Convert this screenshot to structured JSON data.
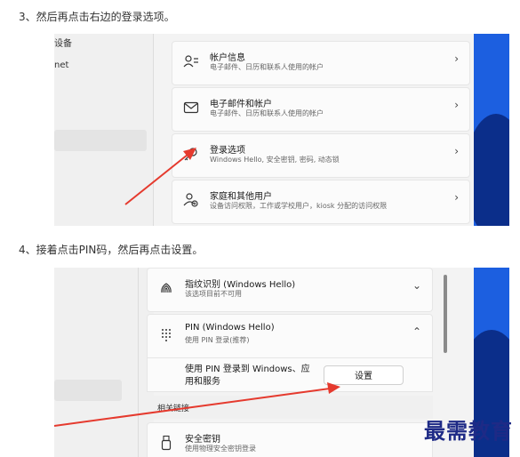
{
  "step3": "3、然后再点击右边的登录选项。",
  "step4": "4、接着点击PIN码，然后再点击设置。",
  "shot1": {
    "nav_frag1": "设备",
    "nav_frag2": "net",
    "cards": [
      {
        "title": "帐户信息",
        "sub": "电子邮件、日历和联系人使用的帐户",
        "icon": "account-info-icon"
      },
      {
        "title": "电子邮件和帐户",
        "sub": "电子邮件、日历和联系人使用的帐户",
        "icon": "email-icon"
      },
      {
        "title": "登录选项",
        "sub": "Windows Hello, 安全密钥, 密码, 动态锁",
        "icon": "key-icon"
      },
      {
        "title": "家庭和其他用户",
        "sub": "设备访问权限，工作或学校用户，kiosk 分配的访问权限",
        "icon": "family-icon"
      }
    ],
    "chevron": "›"
  },
  "shot2": {
    "fingerprint": {
      "title": "指纹识别 (Windows Hello)",
      "sub": "该选项目前不可用",
      "icon": "fingerprint-icon"
    },
    "pin": {
      "title": "PIN (Windows Hello)",
      "sub": "使用 PIN 登录(推荐)",
      "icon": "pin-keypad-icon"
    },
    "pin_desc": "使用 PIN 登录到 Windows、应用和服务",
    "setup_button": "设置",
    "related_label": "相关链接",
    "security_key": {
      "title": "安全密钥",
      "sub": "使用物理安全密钥登录",
      "icon": "usb-key-icon"
    },
    "chev_down": "⌄",
    "chev_up": "⌃"
  },
  "watermark": "最需教育",
  "colors": {
    "arrow": "#e53a2e",
    "wallpaper": "#1c5fe0",
    "watermark": "#1e2a86"
  }
}
